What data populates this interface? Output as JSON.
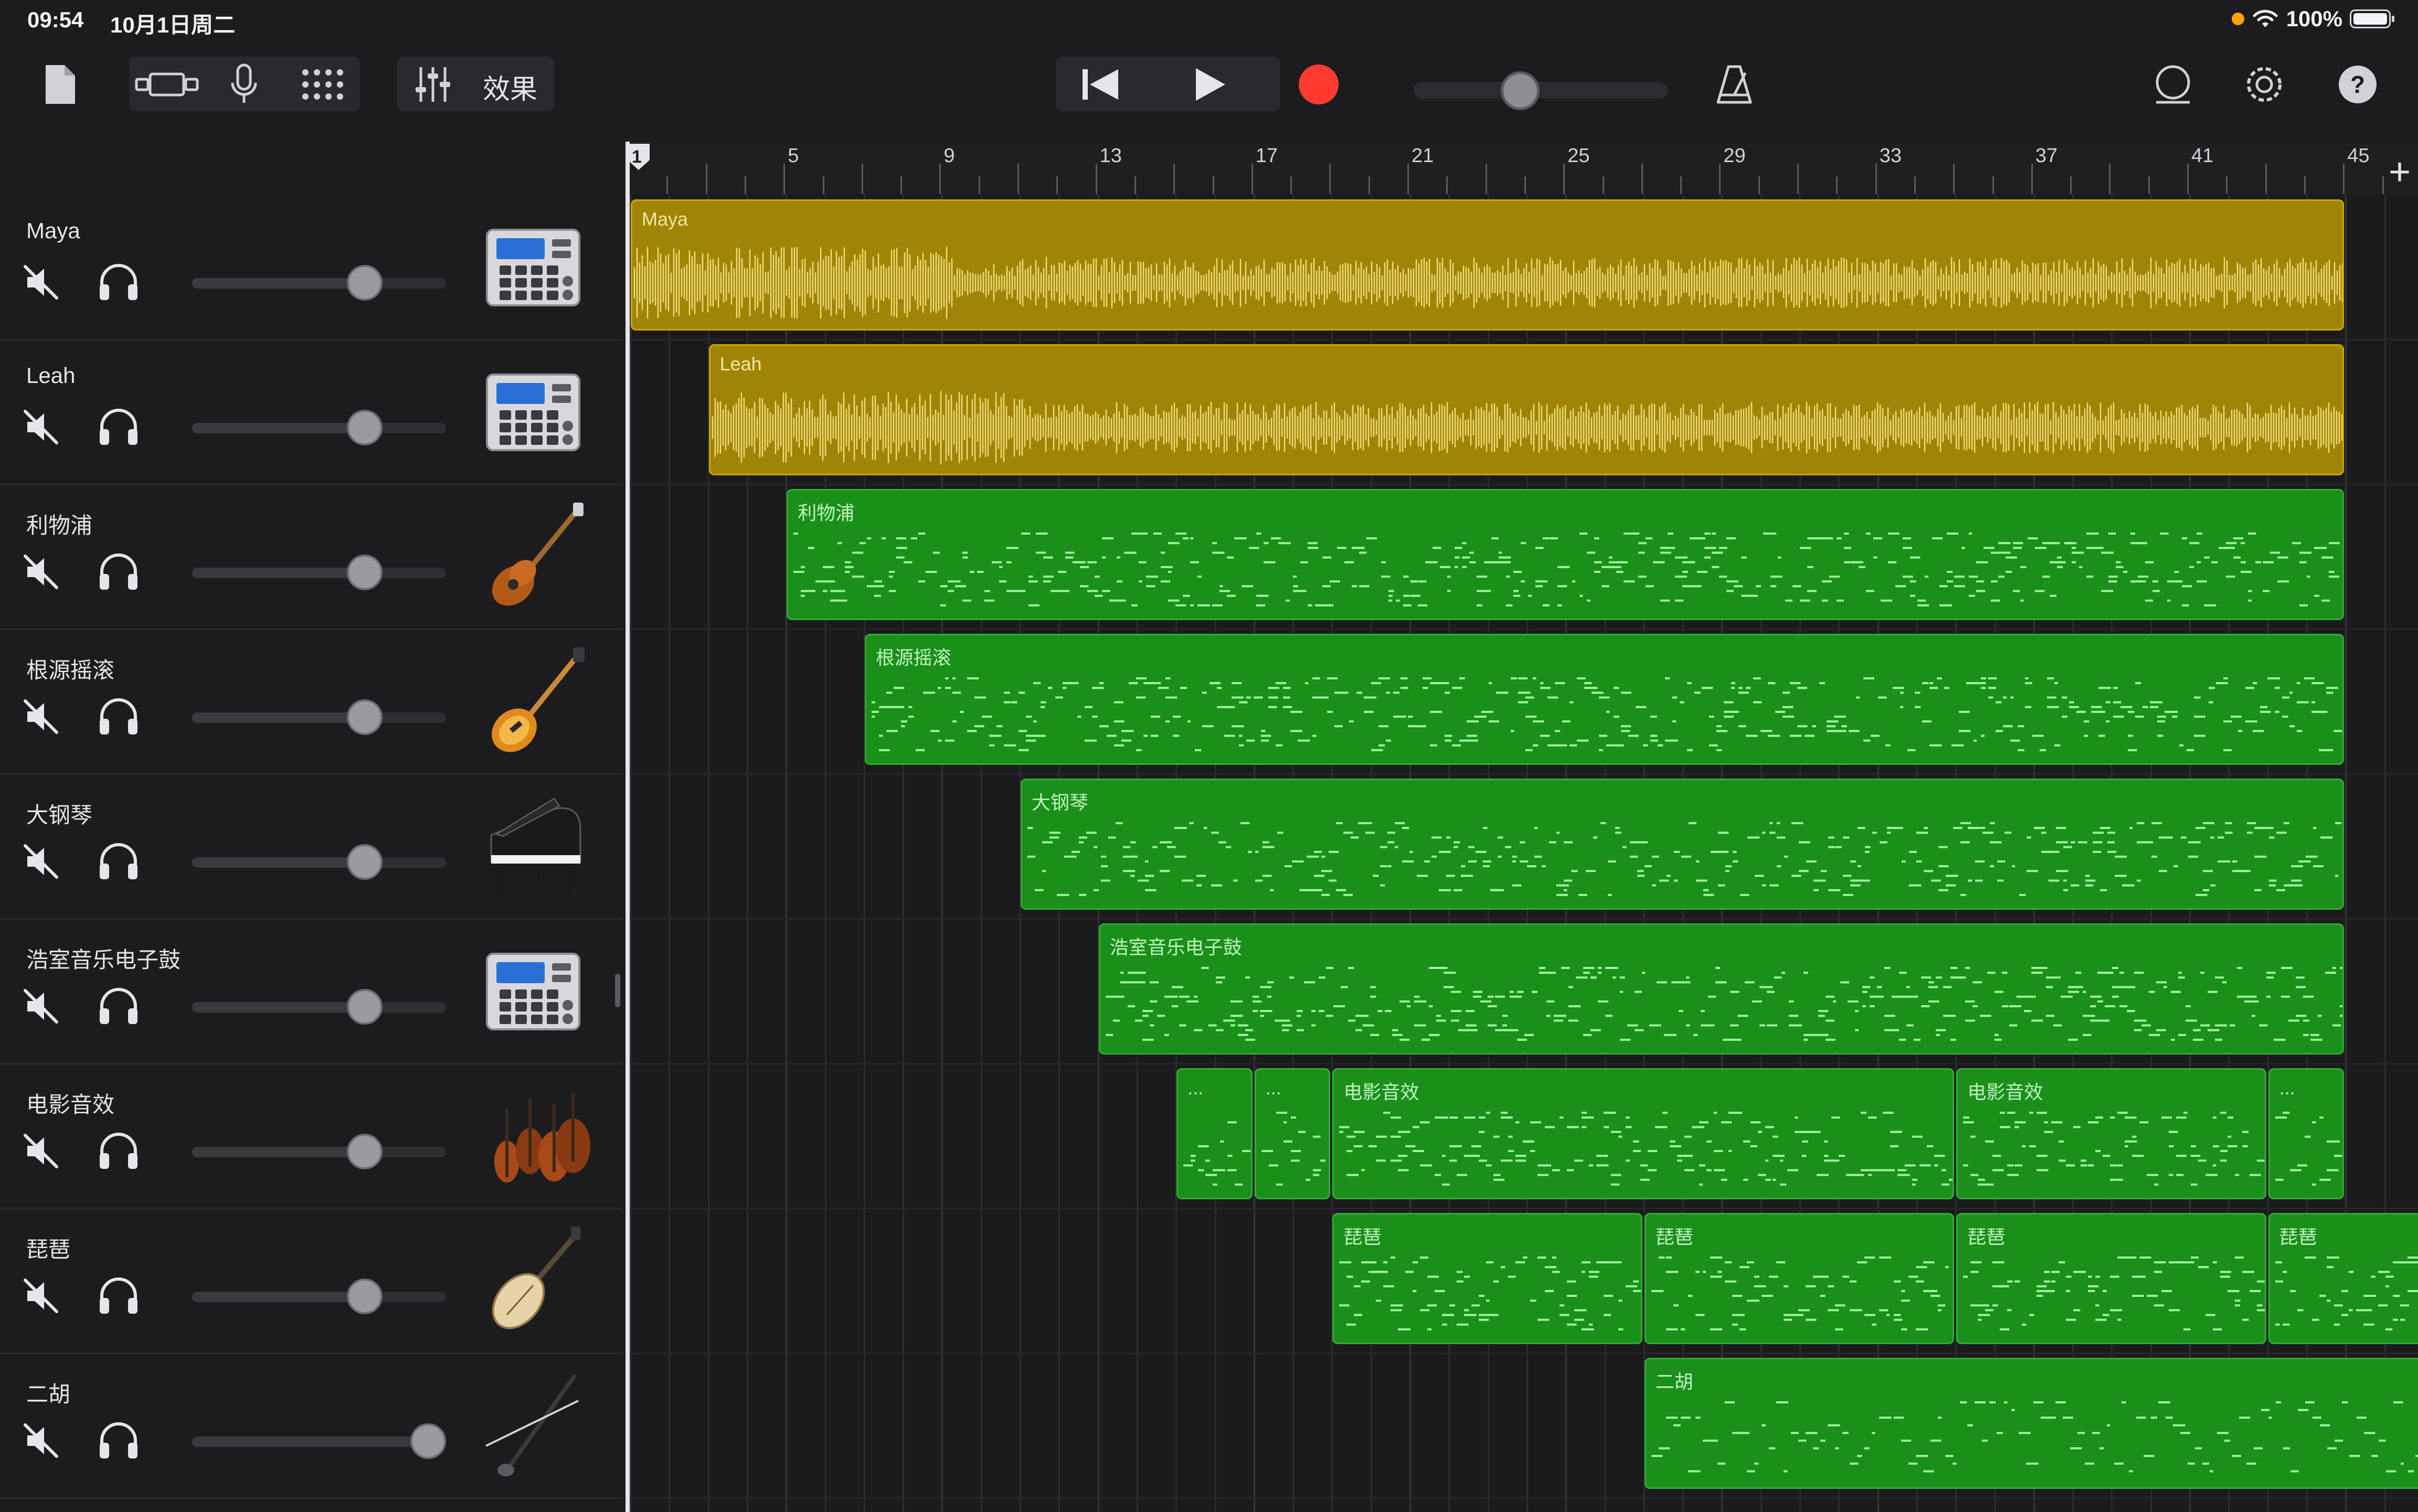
{
  "status": {
    "time": "09:54",
    "date": "10月1日周二",
    "battery": "100%"
  },
  "toolbar": {
    "fx_label": "效果",
    "icons": [
      "document-icon",
      "track-view-icon",
      "microphone-icon",
      "grid-icon",
      "mixer-icon",
      "rewind-icon",
      "play-icon",
      "record-icon",
      "metronome-icon",
      "loop-browser-icon",
      "settings-icon",
      "help-icon"
    ],
    "record_color": "#ff3b30",
    "master_volume": 0.42
  },
  "ruler": {
    "playhead": "1",
    "bars": [
      "5",
      "9",
      "13",
      "17",
      "21",
      "25",
      "29",
      "33",
      "37",
      "41",
      "45"
    ]
  },
  "tracks": [
    {
      "name": "Maya",
      "instrument": "drum-machine-icon",
      "volume": 0.68,
      "color": "#a08405"
    },
    {
      "name": "Leah",
      "instrument": "drum-machine-icon",
      "volume": 0.68,
      "color": "#a08405"
    },
    {
      "name": "利物浦",
      "instrument": "bass-guitar-icon",
      "volume": 0.68,
      "color": "#1a8f1a"
    },
    {
      "name": "根源摇滚",
      "instrument": "electric-guitar-icon",
      "volume": 0.68,
      "color": "#1a8f1a"
    },
    {
      "name": "大钢琴",
      "instrument": "grand-piano-icon",
      "volume": 0.68,
      "color": "#1a8f1a"
    },
    {
      "name": "浩室音乐电子鼓",
      "instrument": "drum-machine-icon",
      "volume": 0.68,
      "color": "#1a8f1a"
    },
    {
      "name": "电影音效",
      "instrument": "strings-icon",
      "volume": 0.68,
      "color": "#1a8f1a"
    },
    {
      "name": "琵琶",
      "instrument": "pipa-icon",
      "volume": 0.68,
      "color": "#1a8f1a"
    },
    {
      "name": "二胡",
      "instrument": "erhu-icon",
      "volume": 0.93,
      "color": "#1a8f1a"
    }
  ],
  "regions": [
    {
      "track": 0,
      "label": "Maya",
      "type": "audio"
    },
    {
      "track": 1,
      "label": "Leah",
      "type": "audio"
    },
    {
      "track": 2,
      "label": "利物浦",
      "type": "midi"
    },
    {
      "track": 3,
      "label": "根源摇滚",
      "type": "midi"
    },
    {
      "track": 4,
      "label": "大钢琴",
      "type": "midi"
    },
    {
      "track": 5,
      "label": "浩室音乐电子鼓",
      "type": "midi"
    },
    {
      "track": 6,
      "label": "...",
      "type": "midi"
    },
    {
      "track": 6,
      "label": "...",
      "type": "midi"
    },
    {
      "track": 6,
      "label": "电影音效",
      "type": "midi"
    },
    {
      "track": 6,
      "label": "电影音效",
      "type": "midi"
    },
    {
      "track": 6,
      "label": "...",
      "type": "midi"
    },
    {
      "track": 7,
      "label": "琵琶",
      "type": "midi"
    },
    {
      "track": 7,
      "label": "琵琶",
      "type": "midi"
    },
    {
      "track": 7,
      "label": "琵琶",
      "type": "midi"
    },
    {
      "track": 7,
      "label": "琵琶",
      "type": "midi"
    },
    {
      "track": 8,
      "label": "二胡",
      "type": "midi"
    }
  ]
}
